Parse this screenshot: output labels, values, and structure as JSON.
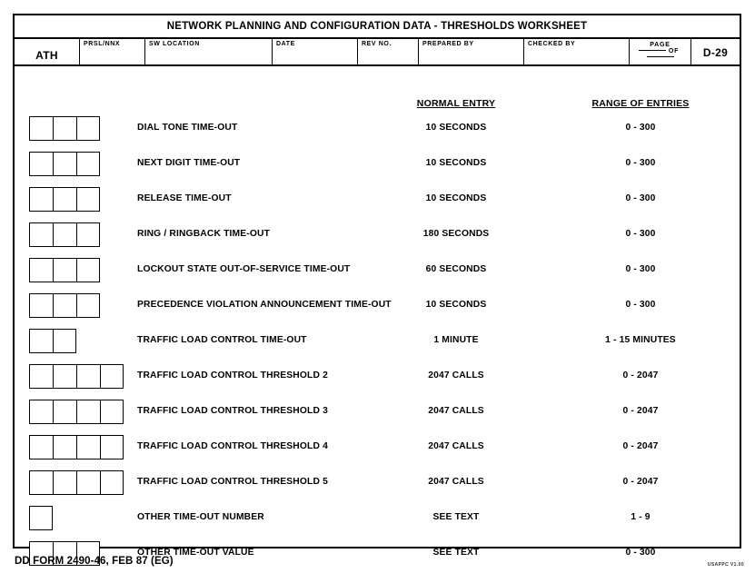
{
  "form": {
    "title": "NETWORK PLANNING AND CONFIGURATION DATA - THRESHOLDS WORKSHEET",
    "footer_left": "DD FORM 2490-46, FEB 87 (EG)",
    "footer_right": "USAPPC V1.00"
  },
  "header": {
    "ath_label": "",
    "ath_value": "ATH",
    "prsl_label": "PRSL/NNX",
    "prsl_value": "",
    "sw_location_label": "SW LOCATION",
    "sw_location_value": "",
    "date_label": "DATE",
    "date_value": "",
    "rev_no_label": "REV NO.",
    "rev_no_value": "",
    "prepared_by_label": "PREPARED BY",
    "prepared_by_value": "",
    "checked_by_label": "CHECKED BY",
    "checked_by_value": "",
    "page_label": "PAGE",
    "page_of_word": "OF",
    "page_number": "",
    "page_total": "",
    "form_page_id": "D-29"
  },
  "columns": {
    "normal_entry": "NORMAL ENTRY",
    "range_of_entries": "RANGE OF ENTRIES"
  },
  "rows": [
    {
      "label": "DIAL TONE TIME-OUT",
      "boxes": 3,
      "normal": "10 SECONDS",
      "range": "0 - 300"
    },
    {
      "label": "NEXT DIGIT TIME-OUT",
      "boxes": 3,
      "normal": "10 SECONDS",
      "range": "0 - 300"
    },
    {
      "label": "RELEASE TIME-OUT",
      "boxes": 3,
      "normal": "10 SECONDS",
      "range": "0 - 300"
    },
    {
      "label": "RING / RINGBACK TIME-OUT",
      "boxes": 3,
      "normal": "180 SECONDS",
      "range": "0 - 300"
    },
    {
      "label": "LOCKOUT STATE OUT-OF-SERVICE TIME-OUT",
      "boxes": 3,
      "normal": "60 SECONDS",
      "range": "0 - 300"
    },
    {
      "label": "PRECEDENCE VIOLATION ANNOUNCEMENT TIME-OUT",
      "boxes": 3,
      "normal": "10 SECONDS",
      "range": "0 - 300"
    },
    {
      "label": "TRAFFIC LOAD CONTROL TIME-OUT",
      "boxes": 2,
      "normal": "1 MINUTE",
      "range": "1 - 15 MINUTES"
    },
    {
      "label": "TRAFFIC LOAD CONTROL THRESHOLD 2",
      "boxes": 4,
      "normal": "2047 CALLS",
      "range": "0 - 2047"
    },
    {
      "label": "TRAFFIC LOAD CONTROL THRESHOLD 3",
      "boxes": 4,
      "normal": "2047 CALLS",
      "range": "0 - 2047"
    },
    {
      "label": "TRAFFIC LOAD CONTROL THRESHOLD 4",
      "boxes": 4,
      "normal": "2047 CALLS",
      "range": "0 - 2047"
    },
    {
      "label": "TRAFFIC LOAD CONTROL THRESHOLD 5",
      "boxes": 4,
      "normal": "2047 CALLS",
      "range": "0 - 2047"
    },
    {
      "label": "OTHER TIME-OUT NUMBER",
      "boxes": 1,
      "normal": "SEE TEXT",
      "range": "1 - 9"
    },
    {
      "label": "OTHER TIME-OUT VALUE",
      "boxes": 3,
      "normal": "SEE TEXT",
      "range": "0 - 300"
    }
  ]
}
